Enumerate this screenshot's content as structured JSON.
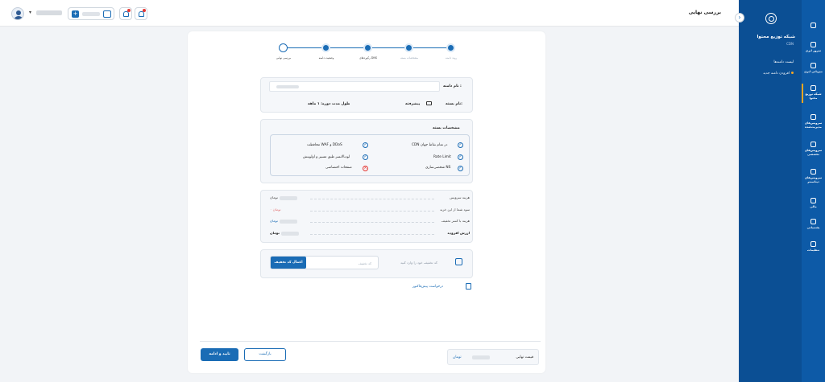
{
  "header": {
    "title": "بررسی نهایی"
  },
  "right_nav": [
    {
      "label": "",
      "icon": "home-icon"
    },
    {
      "label": "سرور ابری",
      "icon": "server-icon"
    },
    {
      "label": "میزبانی ابری",
      "icon": "hosting-icon"
    },
    {
      "label": "شبکه توزیع محتوا",
      "icon": "cdn-icon"
    },
    {
      "label": "سرویس‌های مدیریت‌شده",
      "icon": "managed-icon"
    },
    {
      "label": "سرویس‌های تخصصی",
      "icon": "special-icon"
    },
    {
      "label": "سرویس‌های دیتاسنتر",
      "icon": "datacenter-icon"
    },
    {
      "label": "مالی",
      "icon": "finance-icon"
    },
    {
      "label": "پشتیبانی",
      "icon": "support-icon"
    },
    {
      "label": "تنظیمات",
      "icon": "settings-icon"
    }
  ],
  "sub_nav": {
    "title": "شبکه توزیع محتوا",
    "subtitle": "CDN",
    "links": [
      "لیست دامنه‌ها",
      "افزودن دامنه جدید"
    ]
  },
  "stepper": [
    {
      "label": "روند دامنه",
      "state": "done"
    },
    {
      "label": "مشخصات بسته",
      "state": "done"
    },
    {
      "label": "رکوردهای DNS",
      "state": "active"
    },
    {
      "label": "وضعیت دامنه",
      "state": "active"
    },
    {
      "label": "بررسی نهایی",
      "state": "inactive"
    }
  ],
  "domain": {
    "label": "نام دامنه :"
  },
  "package": {
    "name_label": "نام بسته:",
    "name_value": "پیشرفته",
    "duration_label": "طول مدت دوره: ۱ ماهه"
  },
  "features": {
    "title": "مشخصات بسته",
    "items": [
      {
        "text": "CDN در تمام نقاط جهان",
        "ok": true
      },
      {
        "text": "محافظت WAF و DDoS",
        "ok": true
      },
      {
        "text": "Rate Limit",
        "ok": true
      },
      {
        "text": "لودبالانسر طبق مسیر و اولویتش",
        "ok": true
      },
      {
        "text": "شخصی‌سازی NS",
        "ok": true
      },
      {
        "text": "صفحات اختصاصی",
        "ok": false
      }
    ]
  },
  "pricing": [
    {
      "name": "هزینه سرویس",
      "value": "تومان",
      "tone": "normal"
    },
    {
      "name": "سود شما از این خرید",
      "value": "۰ تومان",
      "tone": "red"
    },
    {
      "name": "هزینه با کسر تخفیف",
      "value": "تومان",
      "tone": "blue"
    },
    {
      "name": "ارزش افزوده",
      "value": "تومان",
      "tone": "bold"
    }
  ],
  "discount": {
    "prompt": "کد تخفیف خود را وارد کنید",
    "placeholder": "کد تخفیف",
    "apply_label": "اعمال کد تخفیف"
  },
  "invoice_link": "درخواست پیش‌فاکتور",
  "footer": {
    "final_label": "قیمت نهایی",
    "final_value": "تومان",
    "back_label": "بازگشت",
    "confirm_label": "تایید و ادامه"
  }
}
